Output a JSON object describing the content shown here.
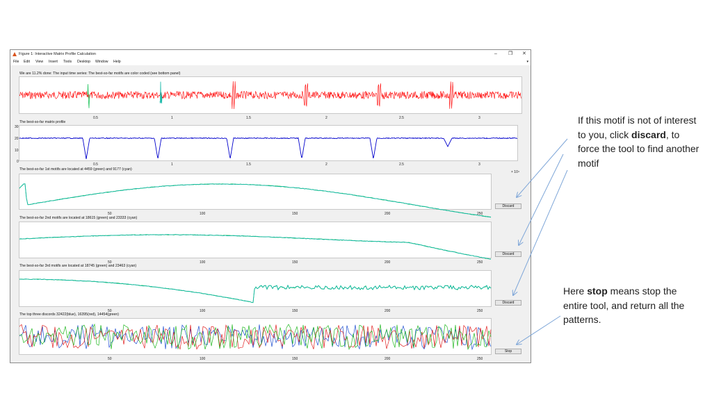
{
  "window": {
    "title": "Figure 1: Interactive Matrix Profile Calculation",
    "controls": {
      "minimize": "–",
      "maximize": "❐",
      "close": "✕"
    },
    "menu": [
      "File",
      "Edit",
      "View",
      "Insert",
      "Tools",
      "Desktop",
      "Window",
      "Help"
    ]
  },
  "panels": {
    "series": {
      "title": "We are 11.2% done: The input time series: The best-so-far motifs are color coded (see bottom panel)",
      "xticks": [
        "0.5",
        "1",
        "1.5",
        "2",
        "2.5",
        "3"
      ]
    },
    "profile": {
      "title": "The best-so-far matrix profile",
      "yticks": [
        "30",
        "20",
        "10",
        "0"
      ],
      "xticks": [
        "0.5",
        "1",
        "1.5",
        "2",
        "2.5",
        "3"
      ],
      "exponent": "× 10⁴"
    },
    "motif1": {
      "title": "The best-so-far 1st motifs are located at 4459 (green) and 9177 (cyan)",
      "xticks": [
        "50",
        "100",
        "150",
        "200",
        "250"
      ]
    },
    "motif2": {
      "title": "The best-so-far 2nd motifs are located at 18615 (green) and 23333 (cyan)",
      "xticks": [
        "50",
        "100",
        "150",
        "200",
        "250"
      ]
    },
    "motif3": {
      "title": "The best-so-far 3rd motifs are located at 18745 (green) and 23463 (cyan)",
      "xticks": [
        "50",
        "100",
        "150",
        "200",
        "250"
      ]
    },
    "discords": {
      "title": "The top three discords 32422(blue), 16395(red), 14454(green)",
      "xticks": [
        "50",
        "100",
        "150",
        "200",
        "250"
      ]
    }
  },
  "buttons": {
    "discard": "Discard",
    "stop": "Stop"
  },
  "annotations": {
    "discard_note": {
      "prefix": "If this motif is not of interest to you, click ",
      "bold": "discard",
      "suffix": ", to force the tool to find another motif"
    },
    "stop_note": {
      "prefix": "Here ",
      "bold": "stop",
      "suffix": " means stop the entire tool, and return all the patterns."
    }
  },
  "colors": {
    "series": "#ff0000",
    "profile": "#0000cc",
    "green": "#22c55e",
    "cyan": "#16b8a8",
    "arrow": "#7ea6d8"
  }
}
